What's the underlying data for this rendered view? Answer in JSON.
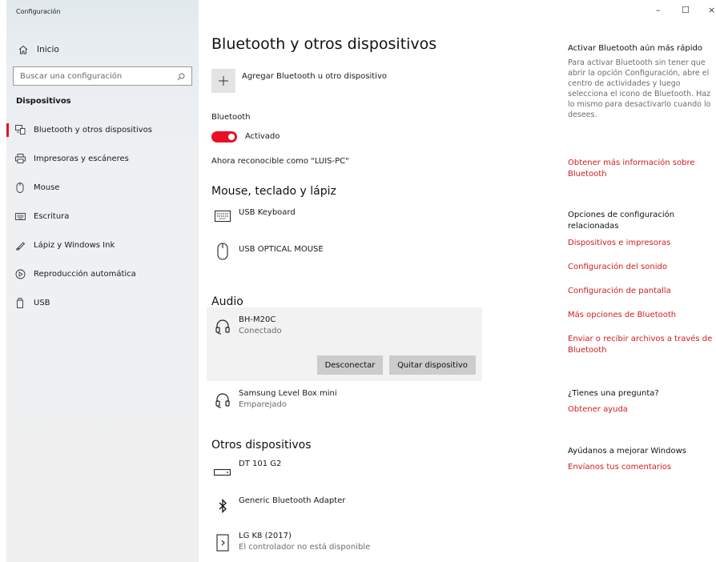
{
  "window": {
    "title": "Configuración",
    "controls": {
      "minimize": "–",
      "maximize": "☐",
      "close": "×"
    }
  },
  "sidebar": {
    "home": {
      "label": "Inicio",
      "icon": "home-icon"
    },
    "search": {
      "placeholder": "Buscar una configuración",
      "value": "",
      "icon": "search-icon"
    },
    "section": "Dispositivos",
    "items": [
      {
        "label": "Bluetooth y otros dispositivos",
        "icon": "bluetooth-devices-icon",
        "selected": true
      },
      {
        "label": "Impresoras y escáneres",
        "icon": "printer-icon",
        "selected": false
      },
      {
        "label": "Mouse",
        "icon": "mouse-icon",
        "selected": false
      },
      {
        "label": "Escritura",
        "icon": "keyboard-icon",
        "selected": false
      },
      {
        "label": "Lápiz y Windows Ink",
        "icon": "pen-icon",
        "selected": false
      },
      {
        "label": "Reproducción automática",
        "icon": "autoplay-icon",
        "selected": false
      },
      {
        "label": "USB",
        "icon": "usb-icon",
        "selected": false
      }
    ]
  },
  "main": {
    "title": "Bluetooth y otros dispositivos",
    "add_device": {
      "label": "Agregar Bluetooth u otro dispositivo",
      "icon": "plus-icon"
    },
    "bluetooth": {
      "label": "Bluetooth",
      "state": "Activado",
      "on": true,
      "discoverable_text": "Ahora reconocible como \"LUIS-PC\""
    },
    "sections": {
      "input": {
        "title": "Mouse, teclado y lápiz",
        "devices": [
          {
            "name": "USB Keyboard",
            "icon": "keyboard-icon"
          },
          {
            "name": "USB OPTICAL MOUSE",
            "icon": "mouse-icon"
          }
        ]
      },
      "audio": {
        "title": "Audio",
        "devices": [
          {
            "name": "BH-M20C",
            "status": "Conectado",
            "icon": "headphones-icon",
            "selected": true
          },
          {
            "name": "Samsung Level Box mini",
            "status": "Emparejado",
            "icon": "headphones-icon"
          }
        ],
        "buttons": {
          "disconnect": "Desconectar",
          "remove": "Quitar dispositivo"
        }
      },
      "other": {
        "title": "Otros dispositivos",
        "devices": [
          {
            "name": "DT 101 G2",
            "icon": "usb-drive-icon"
          },
          {
            "name": "Generic Bluetooth Adapter",
            "icon": "bluetooth-icon"
          },
          {
            "name": "LG K8 (2017)",
            "status": "El controlador no está disponible",
            "icon": "phone-icon"
          }
        ]
      }
    }
  },
  "right_panel": {
    "faster": {
      "heading": "Activar Bluetooth aún más rápido",
      "text": "Para activar Bluetooth sin tener que abrir la opción Configuración, abre el centro de actividades y luego selecciona el icono de Bluetooth. Haz lo mismo para desactivarlo cuando lo desees.",
      "link": "Obtener más información sobre Bluetooth"
    },
    "related": {
      "heading": "Opciones de configuración relacionadas",
      "links": [
        "Dispositivos e impresoras",
        "Configuración del sonido",
        "Configuración de pantalla",
        "Más opciones de Bluetooth",
        "Enviar o recibir archivos a través de Bluetooth"
      ]
    },
    "question": {
      "heading": "¿Tienes una pregunta?",
      "link": "Obtener ayuda"
    },
    "improve": {
      "heading": "Ayúdanos a mejorar Windows",
      "link": "Envíanos tus comentarios"
    }
  },
  "colors": {
    "accent": "#e81123",
    "link": "#d31c1c",
    "sidebar_bg": "#eef0f2"
  }
}
